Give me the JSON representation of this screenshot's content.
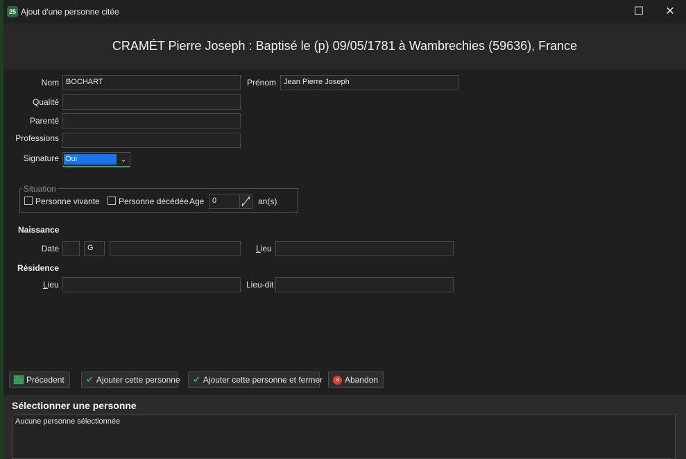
{
  "window": {
    "title": "Ajout d'une personne citée",
    "icon_text": "25",
    "maximize_glyph": "☐",
    "close_glyph": "✕"
  },
  "header": {
    "title": "CRAMÉT Pierre Joseph : Baptisé le (p) 09/05/1781 à Wambrechies (59636), France"
  },
  "form": {
    "nom_label": "Nom",
    "nom_value": "BOCHART",
    "prenom_label": "Prénom",
    "prenom_value": "Jean Pierre Joseph",
    "qualite_label": "Qualité",
    "qualite_value": "",
    "parente_label": "Parenté",
    "parente_value": "",
    "professions_label": "Professions",
    "professions_value": "",
    "signature_label": "Signature",
    "signature_value": "Oui"
  },
  "situation": {
    "legend": "Situation",
    "vivante_label": "Personne vivante",
    "decedee_label": "Personne décédée",
    "age_label": "Age",
    "age_value": "0",
    "age_unit": "an(s)"
  },
  "naissance": {
    "title": "Naissance",
    "date_label": "Date",
    "date_prefix": "",
    "calendar": "G",
    "date_value": "",
    "lieu_label_first": "L",
    "lieu_label_rest": "ieu",
    "lieu_value": ""
  },
  "residence": {
    "title": "Résidence",
    "lieu_label_first": "L",
    "lieu_label_rest": "ieu",
    "lieu_value": "",
    "lieudit_label": "Lieu-dit",
    "lieudit_value": ""
  },
  "buttons": {
    "precedent": "Précedent",
    "ajouter": "Ajouter cette personne",
    "ajouter_fermer": "Ajouter cette personne et fermer",
    "abandon": "Abandon"
  },
  "selection": {
    "title": "Sélectionner une personne",
    "empty_text": "Aucune personne sélectionnée"
  },
  "colors": {
    "accent_green": "#3aa35a",
    "selection_blue": "#1a73e8",
    "cancel_red": "#e03c31"
  }
}
